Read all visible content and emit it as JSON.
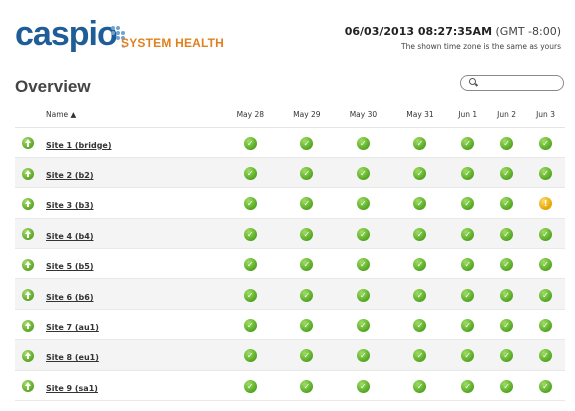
{
  "header": {
    "logo_text": "caspio",
    "logo_tm": "™",
    "product_title": "SYSTEM HEALTH",
    "clock_datetime": "06/03/2013 08:27:35AM",
    "clock_zone": "(GMT -8:00)",
    "clock_note": "The shown time zone is the same as yours"
  },
  "overview": {
    "title": "Overview",
    "search_placeholder": "",
    "name_header": "Name ▲"
  },
  "dates": [
    "May 28",
    "May 29",
    "May 30",
    "May 31",
    "Jun 1",
    "Jun 2",
    "Jun 3"
  ],
  "colors": {
    "ok": "#5ba724",
    "warning": "#e8b000",
    "brand": "#1f5d99",
    "accent": "#e27f1e"
  },
  "sites": [
    {
      "name": "Site 1 (bridge)",
      "status": [
        "ok",
        "ok",
        "ok",
        "ok",
        "ok",
        "ok",
        "ok"
      ]
    },
    {
      "name": "Site 2 (b2)",
      "status": [
        "ok",
        "ok",
        "ok",
        "ok",
        "ok",
        "ok",
        "ok"
      ]
    },
    {
      "name": "Site 3 (b3)",
      "status": [
        "ok",
        "ok",
        "ok",
        "ok",
        "ok",
        "ok",
        "warning"
      ]
    },
    {
      "name": "Site 4 (b4)",
      "status": [
        "ok",
        "ok",
        "ok",
        "ok",
        "ok",
        "ok",
        "ok"
      ]
    },
    {
      "name": "Site 5 (b5)",
      "status": [
        "ok",
        "ok",
        "ok",
        "ok",
        "ok",
        "ok",
        "ok"
      ]
    },
    {
      "name": "Site 6 (b6)",
      "status": [
        "ok",
        "ok",
        "ok",
        "ok",
        "ok",
        "ok",
        "ok"
      ]
    },
    {
      "name": "Site 7 (au1)",
      "status": [
        "ok",
        "ok",
        "ok",
        "ok",
        "ok",
        "ok",
        "ok"
      ]
    },
    {
      "name": "Site 8 (eu1)",
      "status": [
        "ok",
        "ok",
        "ok",
        "ok",
        "ok",
        "ok",
        "ok"
      ]
    },
    {
      "name": "Site 9 (sa1)",
      "status": [
        "ok",
        "ok",
        "ok",
        "ok",
        "ok",
        "ok",
        "ok"
      ]
    }
  ]
}
